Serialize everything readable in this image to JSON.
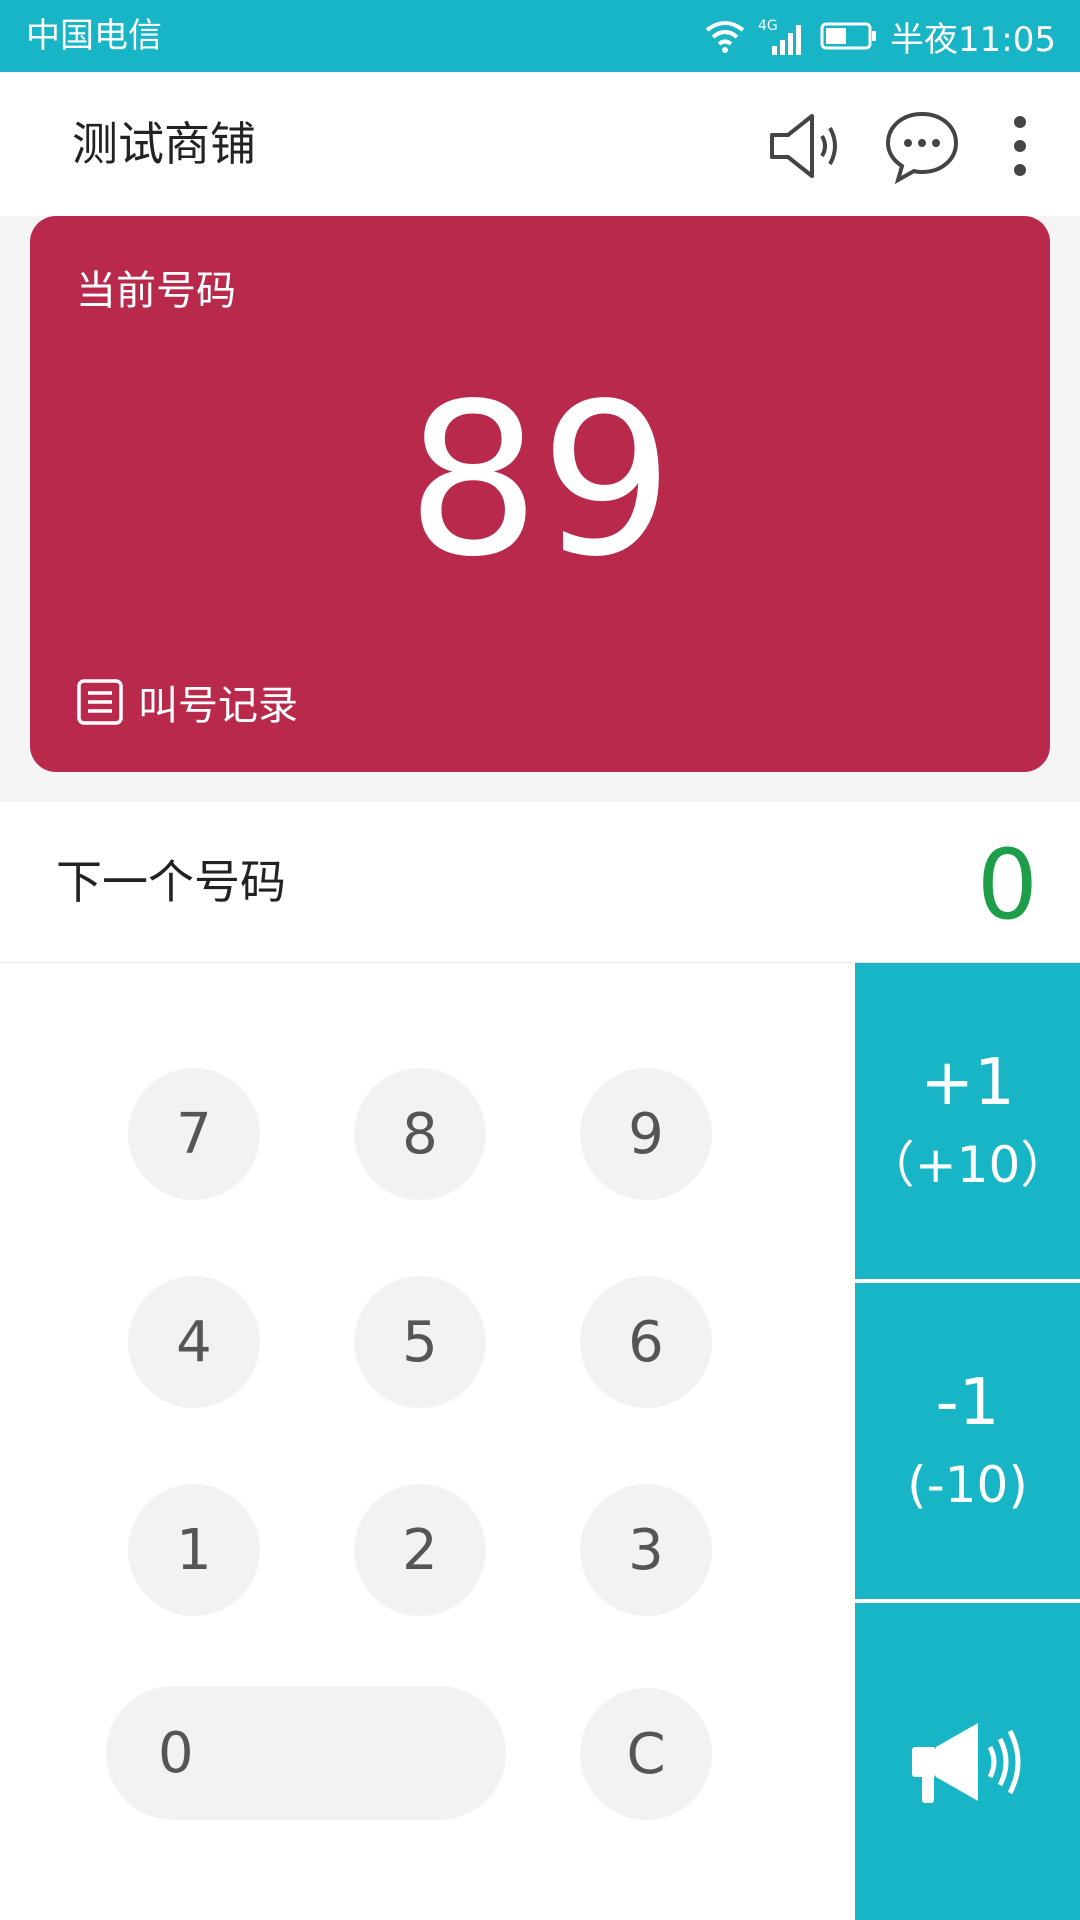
{
  "status_bar": {
    "carrier": "中国电信",
    "network": "4G",
    "clock": "半夜11:05",
    "icons": [
      "wifi-icon",
      "signal-icon",
      "battery-icon"
    ]
  },
  "app_bar": {
    "title": "测试商铺",
    "icons": [
      "speaker-icon",
      "chat-icon",
      "more-vert-icon"
    ]
  },
  "current": {
    "label": "当前号码",
    "number": "89",
    "history_label": "叫号记录",
    "history_icon": "list-icon"
  },
  "next": {
    "label": "下一个号码",
    "value": "0"
  },
  "keypad": {
    "keys": [
      "7",
      "8",
      "9",
      "4",
      "5",
      "6",
      "1",
      "2",
      "3"
    ],
    "zero": "0",
    "clear": "C"
  },
  "actions": {
    "plus_main": "+1",
    "plus_sub": "（+10）",
    "minus_main": "-1",
    "minus_sub": "(-10)",
    "call_icon": "megaphone-icon"
  },
  "colors": {
    "accent": "#17b5c6",
    "card": "#b8294c",
    "next_value": "#1e9e4a",
    "key_bg": "#f2f2f2"
  }
}
